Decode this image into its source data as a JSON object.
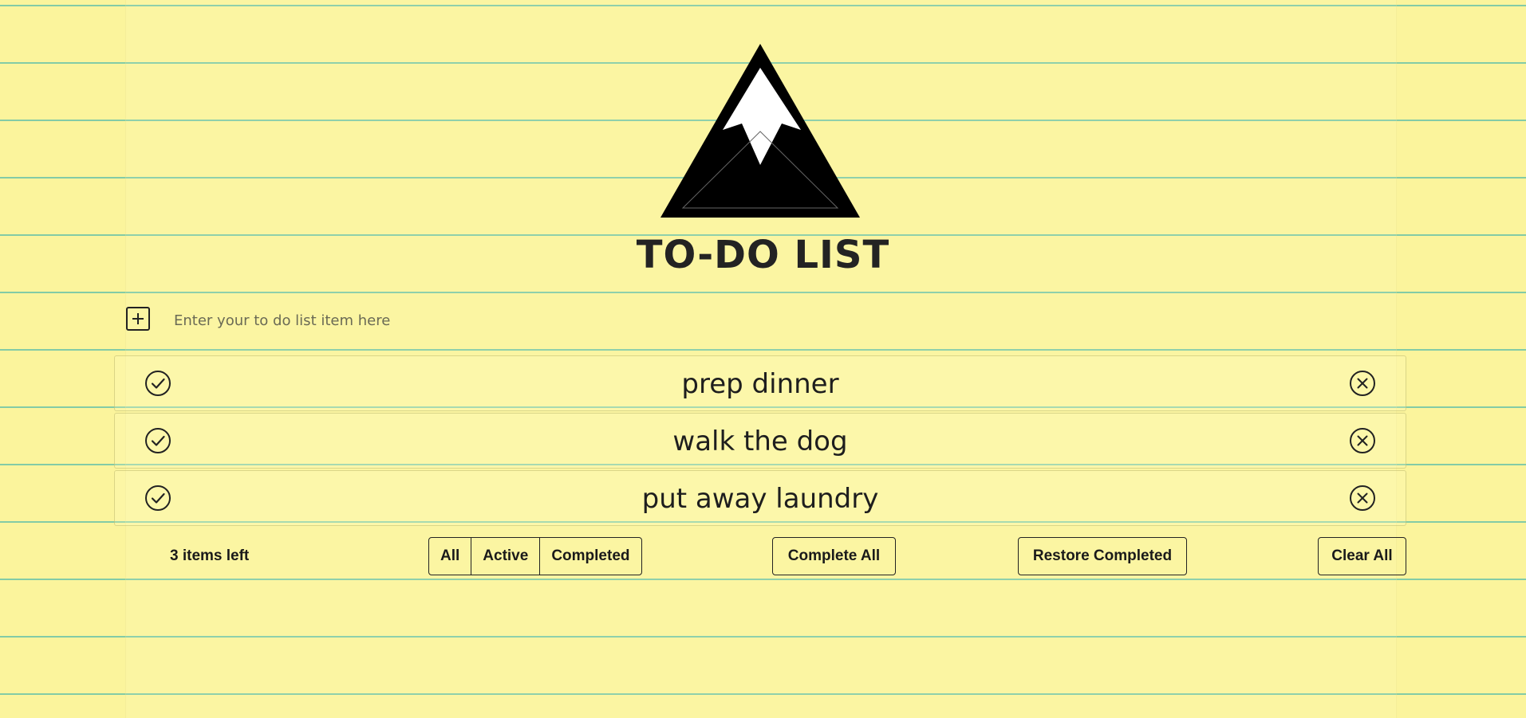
{
  "app": {
    "title": "TO-DO LIST",
    "logo_icon": "mountain-logo-icon",
    "background_color": "#fbf49c",
    "rule_line_color": "#6ec4a8"
  },
  "new_item": {
    "add_icon": "plus-square-icon",
    "placeholder": "Enter your to do list item here",
    "value": ""
  },
  "items": [
    {
      "label": "prep dinner",
      "complete_icon": "check-circle-icon",
      "remove_icon": "x-circle-icon"
    },
    {
      "label": "walk the dog",
      "complete_icon": "check-circle-icon",
      "remove_icon": "x-circle-icon"
    },
    {
      "label": "put away laundry",
      "complete_icon": "check-circle-icon",
      "remove_icon": "x-circle-icon"
    }
  ],
  "footer": {
    "items_left": "3 items left",
    "filters": [
      "All",
      "Active",
      "Completed"
    ],
    "complete_all_label": "Complete All",
    "restore_completed_label": "Restore Completed",
    "clear_all_label": "Clear All"
  }
}
